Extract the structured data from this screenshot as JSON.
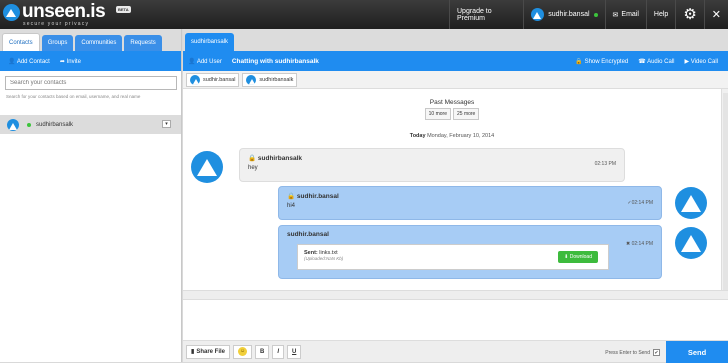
{
  "brand": {
    "name": "unseen.is",
    "tagline": "secure your privacy",
    "badge": "BETA"
  },
  "topnav": {
    "upgrade": "Upgrade to Premium",
    "user": "sudhir.bansal",
    "email": "Email",
    "help": "Help",
    "settings_icon": "gear-icon"
  },
  "left": {
    "tabs": [
      "Contacts",
      "Groups",
      "Communities",
      "Requests"
    ],
    "actions": {
      "add": "Add Contact",
      "invite": "Invite"
    },
    "search": {
      "placeholder": "Search your contacts",
      "hint": "Search for your contacts based on email, username, and real name"
    },
    "contacts": [
      {
        "name": "sudhirbansalk",
        "status": "online"
      }
    ]
  },
  "chat": {
    "tab": "sudhirbansalk",
    "actions": {
      "add_user": "Add User",
      "title": "Chatting with sudhirbansalk",
      "show_encrypted": "Show Encrypted",
      "audio": "Audio Call",
      "video": "Video Call"
    },
    "participants": [
      "sudhir.bansal",
      "sudhirbansalk"
    ],
    "past": {
      "label": "Past Messages",
      "more10": "10 more",
      "more25": "25 more"
    },
    "date": {
      "today": "Today",
      "rest": "Monday, February 10, 2014"
    },
    "messages": [
      {
        "who": "sudhirbansalk",
        "text": "hey",
        "time": "02:13 PM"
      },
      {
        "who": "sudhir.bansal",
        "text": "hi4",
        "time": "02:14 PM",
        "tick": "✓"
      },
      {
        "who": "sudhir.bansal",
        "file_sent_label": "Sent:",
        "file": "links.txt",
        "uploaded": "(Uploaded:NaN Kb)",
        "download": "Download",
        "time": "02:14 PM",
        "status": "✖"
      }
    ]
  },
  "composer": {
    "share": "Share File",
    "bold": "B",
    "italic": "I",
    "underline": "U",
    "enter_label": "Press Enter to Send",
    "send": "Send"
  }
}
